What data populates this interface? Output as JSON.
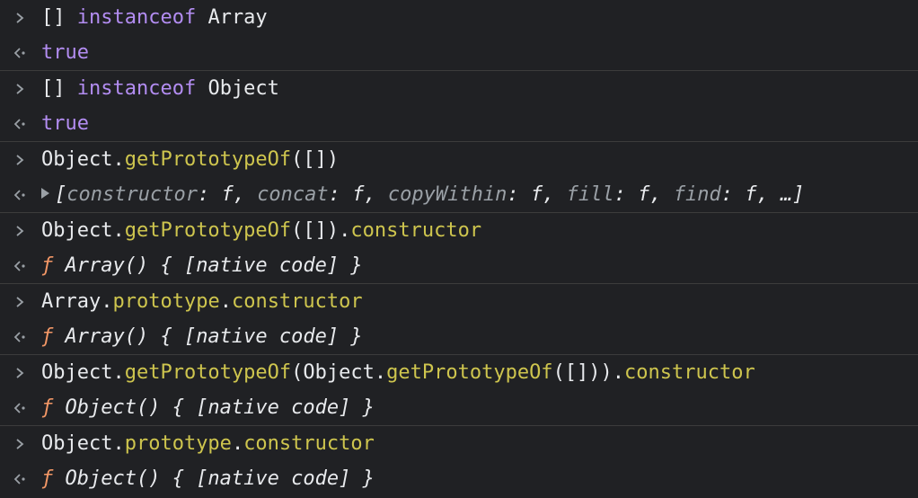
{
  "colors": {
    "background": "#202124",
    "text": "#e8eaed",
    "keyword": "#b38df2",
    "method": "#cec54e",
    "function_marker": "#f29766",
    "muted": "#9aa0a6",
    "divider": "#3c3c3c"
  },
  "icons": {
    "input_prompt": "chevron-right-icon",
    "output_prompt": "return-arrow-icon",
    "expand_triangle": "triangle-right-icon"
  },
  "entries": [
    {
      "input": [
        {
          "text": "[] ",
          "style": "default"
        },
        {
          "text": "instanceof",
          "style": "keyword"
        },
        {
          "text": " Array",
          "style": "default"
        }
      ],
      "output": [
        {
          "text": "true",
          "style": "bool"
        }
      ]
    },
    {
      "input": [
        {
          "text": "[] ",
          "style": "default"
        },
        {
          "text": "instanceof",
          "style": "keyword"
        },
        {
          "text": " Object",
          "style": "default"
        }
      ],
      "output": [
        {
          "text": "true",
          "style": "bool"
        }
      ]
    },
    {
      "input": [
        {
          "text": "Object.",
          "style": "default"
        },
        {
          "text": "getPrototypeOf",
          "style": "method"
        },
        {
          "text": "([])",
          "style": "default"
        }
      ],
      "output_expandable": true,
      "output": [
        {
          "text": "[",
          "style": "obj"
        },
        {
          "text": "constructor",
          "style": "prop"
        },
        {
          "text": ": f, ",
          "style": "obj"
        },
        {
          "text": "concat",
          "style": "prop"
        },
        {
          "text": ": f, ",
          "style": "obj"
        },
        {
          "text": "copyWithin",
          "style": "prop"
        },
        {
          "text": ": f, ",
          "style": "obj"
        },
        {
          "text": "fill",
          "style": "prop"
        },
        {
          "text": ": f, ",
          "style": "obj"
        },
        {
          "text": "find",
          "style": "prop"
        },
        {
          "text": ": f, …]",
          "style": "obj"
        }
      ]
    },
    {
      "input": [
        {
          "text": "Object.",
          "style": "default"
        },
        {
          "text": "getPrototypeOf",
          "style": "method"
        },
        {
          "text": "([]).",
          "style": "default"
        },
        {
          "text": "constructor",
          "style": "method"
        }
      ],
      "output": [
        {
          "text": "ƒ",
          "style": "fn"
        },
        {
          "text": " Array() { [native code] }",
          "style": "fnbody"
        }
      ]
    },
    {
      "input": [
        {
          "text": "Array.",
          "style": "default"
        },
        {
          "text": "prototype",
          "style": "method"
        },
        {
          "text": ".",
          "style": "default"
        },
        {
          "text": "constructor",
          "style": "method"
        }
      ],
      "output": [
        {
          "text": "ƒ",
          "style": "fn"
        },
        {
          "text": " Array() { [native code] }",
          "style": "fnbody"
        }
      ]
    },
    {
      "input": [
        {
          "text": "Object.",
          "style": "default"
        },
        {
          "text": "getPrototypeOf",
          "style": "method"
        },
        {
          "text": "(Object.",
          "style": "default"
        },
        {
          "text": "getPrototypeOf",
          "style": "method"
        },
        {
          "text": "([])).",
          "style": "default"
        },
        {
          "text": "constructor",
          "style": "method"
        }
      ],
      "output": [
        {
          "text": "ƒ",
          "style": "fn"
        },
        {
          "text": " Object() { [native code] }",
          "style": "fnbody"
        }
      ]
    },
    {
      "input": [
        {
          "text": "Object.",
          "style": "default"
        },
        {
          "text": "prototype",
          "style": "method"
        },
        {
          "text": ".",
          "style": "default"
        },
        {
          "text": "constructor",
          "style": "method"
        }
      ],
      "output": [
        {
          "text": "ƒ",
          "style": "fn"
        },
        {
          "text": " Object() { [native code] }",
          "style": "fnbody"
        }
      ]
    }
  ]
}
